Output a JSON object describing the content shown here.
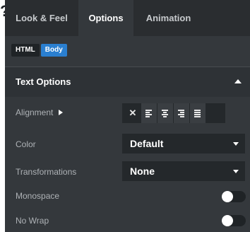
{
  "tabs": [
    {
      "label": "Look & Feel",
      "active": false
    },
    {
      "label": "Options",
      "active": true
    },
    {
      "label": "Animation",
      "active": false
    }
  ],
  "subtabs": {
    "html": "HTML",
    "body": "Body",
    "active": "Body"
  },
  "section": {
    "title": "Text Options",
    "state": "expanded"
  },
  "alignment": {
    "label": "Alignment",
    "options": [
      "clear",
      "align-left",
      "align-center",
      "align-right",
      "justify"
    ]
  },
  "color": {
    "label": "Color",
    "value": "Default"
  },
  "transformations": {
    "label": "Transformations",
    "value": "None"
  },
  "monospace": {
    "label": "Monospace",
    "enabled": false
  },
  "nowrap": {
    "label": "No Wrap",
    "enabled": false
  },
  "colors": {
    "accent": "#2a7fd0",
    "panel": "#34383c",
    "tabbar": "#2a2d30"
  }
}
